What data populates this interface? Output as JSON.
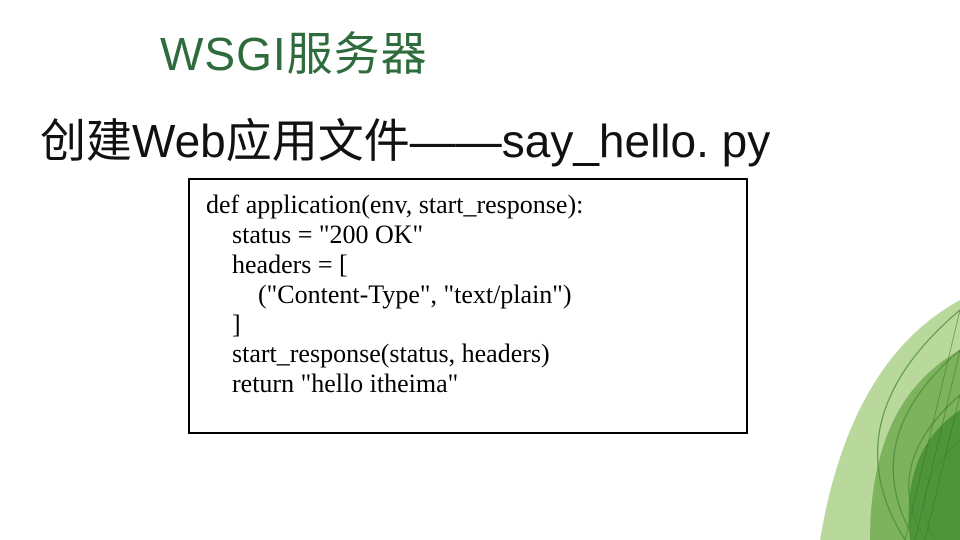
{
  "title": "WSGI服务器",
  "subtitle": "创建Web应用文件——say_hello. py",
  "code": "def application(env, start_response):\n    status = \"200 OK\"\n    headers = [\n        (\"Content-Type\", \"text/plain\")\n    ]\n    start_response(status, headers)\n    return \"hello itheima\""
}
